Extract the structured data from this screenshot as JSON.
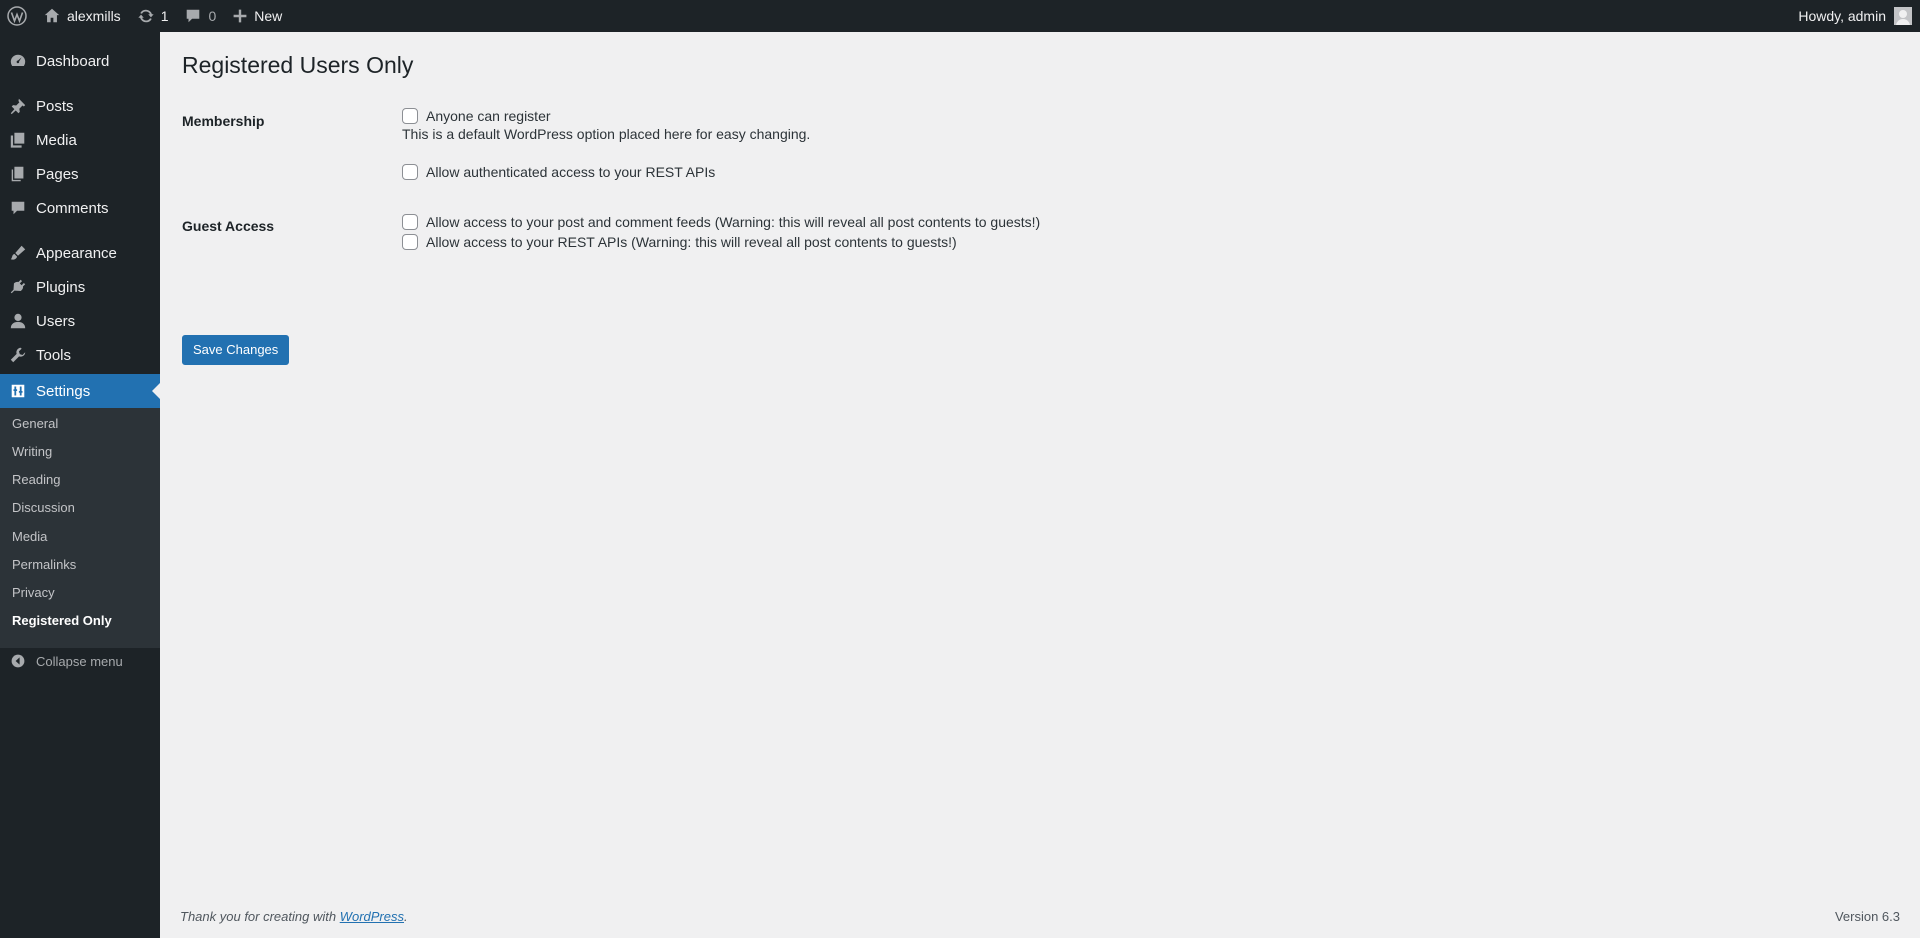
{
  "admin_bar": {
    "site_name": "alexmills",
    "updates_count": "1",
    "comments_count": "0",
    "new_label": "New",
    "greeting": "Howdy, admin"
  },
  "sidebar": {
    "items": [
      {
        "label": "Dashboard",
        "icon": "dashboard-icon"
      },
      {
        "label": "Posts",
        "icon": "pin-icon"
      },
      {
        "label": "Media",
        "icon": "media-icon"
      },
      {
        "label": "Pages",
        "icon": "pages-icon"
      },
      {
        "label": "Comments",
        "icon": "comment-icon"
      },
      {
        "label": "Appearance",
        "icon": "brush-icon"
      },
      {
        "label": "Plugins",
        "icon": "plugin-icon"
      },
      {
        "label": "Users",
        "icon": "user-icon"
      },
      {
        "label": "Tools",
        "icon": "wrench-icon"
      },
      {
        "label": "Settings",
        "icon": "settings-icon"
      }
    ],
    "submenu": [
      "General",
      "Writing",
      "Reading",
      "Discussion",
      "Media",
      "Permalinks",
      "Privacy",
      "Registered Only"
    ],
    "collapse_label": "Collapse menu"
  },
  "page": {
    "title": "Registered Users Only",
    "membership_label": "Membership",
    "anyone_can_register": "Anyone can register",
    "membership_desc": "This is a default WordPress option placed here for easy changing.",
    "allow_auth_rest": "Allow authenticated access to your REST APIs",
    "guest_access_label": "Guest Access",
    "allow_feeds": "Allow access to your post and comment feeds (Warning: this will reveal all post contents to guests!)",
    "allow_rest": "Allow access to your REST APIs (Warning: this will reveal all post contents to guests!)",
    "save_label": "Save Changes"
  },
  "footer": {
    "thanks_prefix": "Thank you for creating with ",
    "wordpress_link": "WordPress",
    "thanks_suffix": ".",
    "version": "Version 6.3"
  },
  "colors": {
    "admin_bar_bg": "#1d2327",
    "accent": "#2271b1",
    "submenu_bg": "#2c3338",
    "content_bg": "#f0f0f1"
  }
}
